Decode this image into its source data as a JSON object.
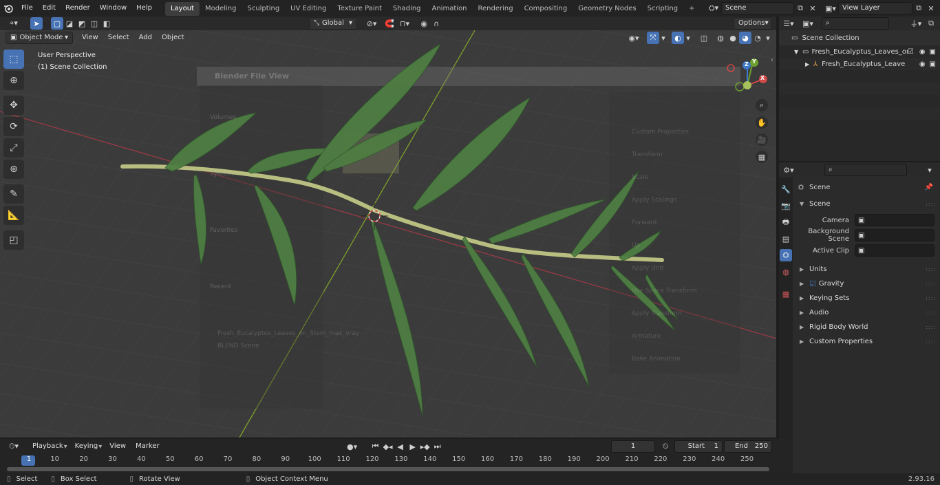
{
  "topbar": {
    "menus": [
      "File",
      "Edit",
      "Render",
      "Window",
      "Help"
    ],
    "workspaces": [
      "Layout",
      "Modeling",
      "Sculpting",
      "UV Editing",
      "Texture Paint",
      "Shading",
      "Animation",
      "Rendering",
      "Compositing",
      "Geometry Nodes",
      "Scripting"
    ],
    "active_workspace": "Layout",
    "add_tab": "+",
    "scene": "Scene",
    "view_layer": "View Layer"
  },
  "header3d": {
    "mode": "Object Mode",
    "menus": [
      "View",
      "Select",
      "Add",
      "Object"
    ],
    "orientation": "Global",
    "options": "Options"
  },
  "viewport": {
    "perspective": "User Perspective",
    "collection": "(1) Scene Collection",
    "ghost_dialog_title": "Blender File View",
    "ghost_sidebar": [
      "Volumes",
      "System",
      "Favorites",
      "Recent"
    ],
    "ghost_recent": [
      "Fresh_Eucalyptus_Leaves_on_Stem_max_vray",
      "BLEND Scene"
    ],
    "ghost_right": [
      "Custom Properties",
      "Transform",
      "Scale",
      "Apply Scalings",
      "Forward",
      "Up",
      "Apply Unit",
      "Use Space Transform",
      "Apply Transform",
      "Armature",
      "Bake Animation"
    ],
    "gizmo": {
      "x": "X",
      "y": "Y",
      "z": "Z"
    }
  },
  "outliner": {
    "root": "Scene Collection",
    "collection": "Fresh_Eucalyptus_Leaves_on",
    "object": "Fresh_Eucalyptus_Leave"
  },
  "properties": {
    "title": "Scene",
    "section": "Scene",
    "rows": [
      {
        "label": "Camera",
        "value": ""
      },
      {
        "label": "Background Scene",
        "value": ""
      },
      {
        "label": "Active Clip",
        "value": ""
      }
    ],
    "panels": [
      "Units",
      "Gravity",
      "Keying Sets",
      "Audio",
      "Rigid Body World",
      "Custom Properties"
    ]
  },
  "timeline": {
    "menus": [
      "Playback",
      "Keying",
      "View",
      "Marker"
    ],
    "current_frame": "1",
    "start_label": "Start",
    "start": "1",
    "end_label": "End",
    "end": "250",
    "ticks": [
      "1",
      "10",
      "20",
      "30",
      "40",
      "50",
      "60",
      "70",
      "80",
      "90",
      "100",
      "110",
      "120",
      "130",
      "140",
      "150",
      "160",
      "170",
      "180",
      "190",
      "200",
      "210",
      "220",
      "230",
      "240",
      "250"
    ]
  },
  "statusbar": {
    "items": [
      "Select",
      "Box Select",
      "Rotate View",
      "Object Context Menu"
    ],
    "version": "2.93.16"
  },
  "colors": {
    "accent": "#4772b3",
    "bg": "#3a3a3a",
    "leaf": "#5a8a4a",
    "stem": "#a8b070"
  }
}
